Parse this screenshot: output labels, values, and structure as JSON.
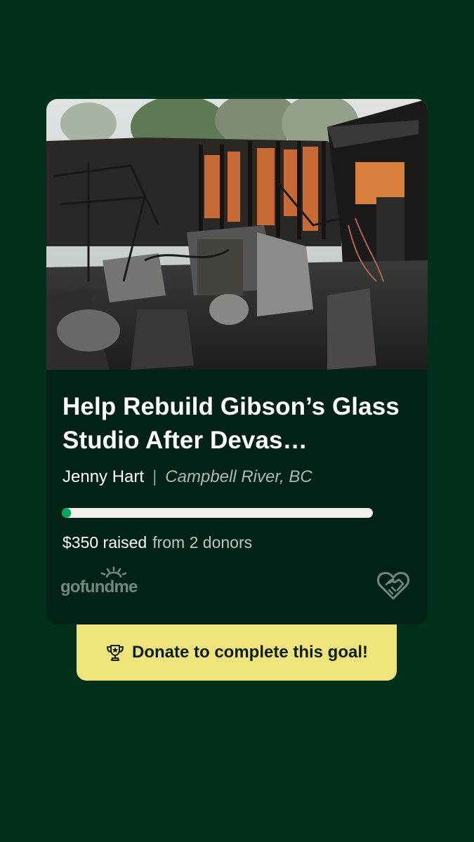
{
  "campaign": {
    "title": "Help Rebuild Gibson’s Glass Studio After Devas…",
    "organizer": "Jenny Hart",
    "separator": "|",
    "location": "Campbell River, BC",
    "progress_fraction": 0.02,
    "amount_raised": "$350 raised",
    "donors_text": "from 2 donors",
    "photo_alt": "Photo"
  },
  "brand": {
    "logo_text": "gofundme",
    "accent_color": "#02a95c",
    "background_color": "#02301b",
    "cta_color": "#f0e47c"
  },
  "cta": {
    "label": "Donate to complete this goal!",
    "icon": "trophy-icon"
  },
  "icons": {
    "footer_right": "heart-handshake-icon"
  }
}
